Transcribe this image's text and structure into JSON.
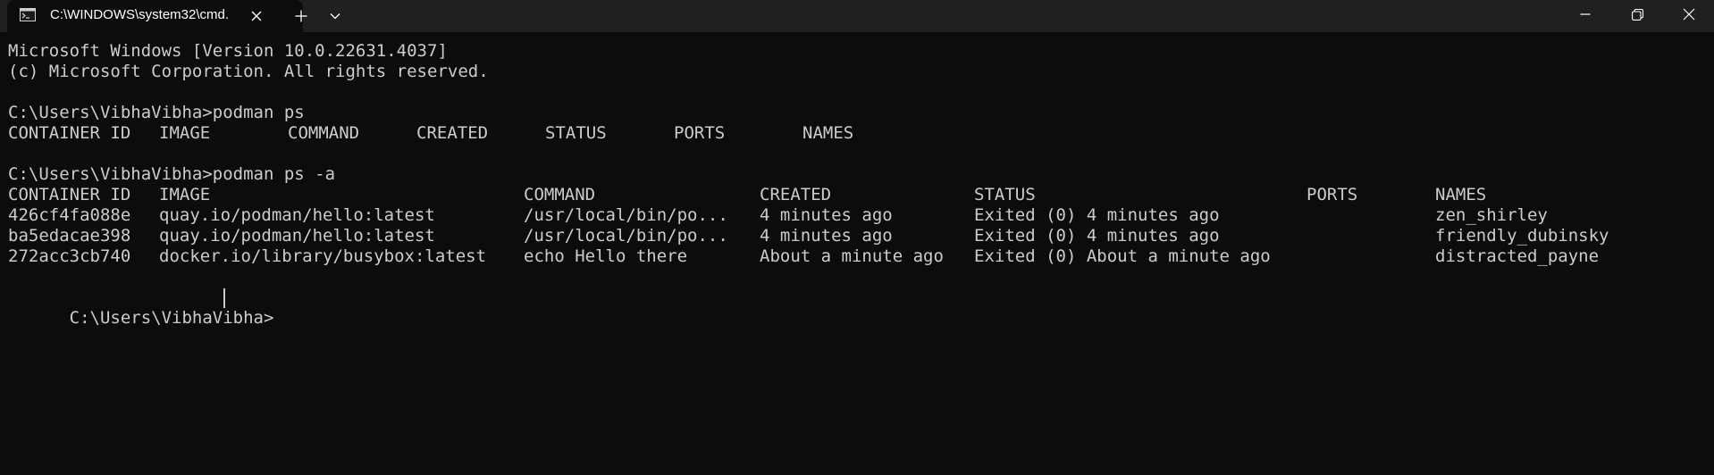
{
  "tab": {
    "title": "C:\\WINDOWS\\system32\\cmd.",
    "icon": "cmd-icon"
  },
  "window_controls": {
    "minimize": "minimize-icon",
    "maximize": "maximize-icon",
    "close": "close-icon"
  },
  "terminal": {
    "header_line1": "Microsoft Windows [Version 10.0.22631.4037]",
    "header_line2": "(c) Microsoft Corporation. All rights reserved.",
    "cmd1": "C:\\Users\\VibhaVibha>podman ps",
    "ps_columns": [
      "CONTAINER ID",
      "IMAGE",
      "COMMAND",
      "CREATED",
      "STATUS",
      "PORTS",
      "NAMES"
    ],
    "cmd2": "C:\\Users\\VibhaVibha>podman ps -a",
    "ps_a_columns": [
      "CONTAINER ID",
      "IMAGE",
      "COMMAND",
      "CREATED",
      "STATUS",
      "PORTS",
      "NAMES"
    ],
    "ps_a_rows": [
      {
        "container_id": "426cf4fa088e",
        "image": "quay.io/podman/hello:latest",
        "command": "/usr/local/bin/po...",
        "created": "4 minutes ago",
        "status": "Exited (0) 4 minutes ago",
        "ports": "",
        "names": "zen_shirley"
      },
      {
        "container_id": "ba5edacae398",
        "image": "quay.io/podman/hello:latest",
        "command": "/usr/local/bin/po...",
        "created": "4 minutes ago",
        "status": "Exited (0) 4 minutes ago",
        "ports": "",
        "names": "friendly_dubinsky"
      },
      {
        "container_id": "272acc3cb740",
        "image": "docker.io/library/busybox:latest",
        "command": "echo Hello there",
        "created": "About a minute ago",
        "status": "Exited (0) About a minute ago",
        "ports": "",
        "names": "distracted_payne"
      }
    ],
    "prompt": "C:\\Users\\VibhaVibha>"
  },
  "colors": {
    "background": "#0c0c0c",
    "titlebar": "#202020",
    "text": "#cccccc"
  }
}
